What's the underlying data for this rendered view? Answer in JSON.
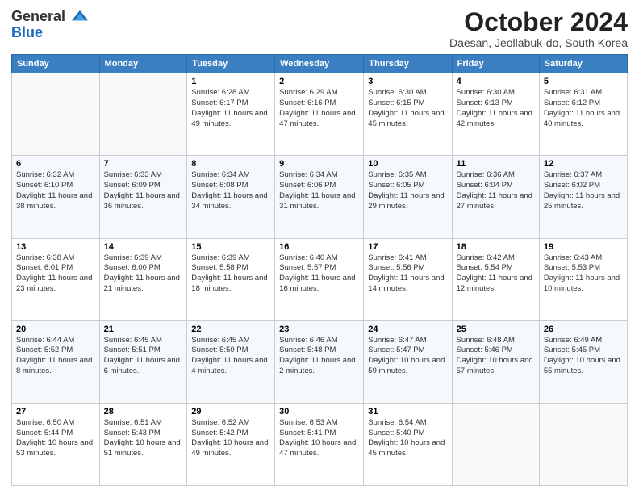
{
  "header": {
    "logo_line1": "General",
    "logo_line2": "Blue",
    "month": "October 2024",
    "location": "Daesan, Jeollabuk-do, South Korea"
  },
  "weekdays": [
    "Sunday",
    "Monday",
    "Tuesday",
    "Wednesday",
    "Thursday",
    "Friday",
    "Saturday"
  ],
  "weeks": [
    [
      {
        "day": "",
        "sunrise": "",
        "sunset": "",
        "daylight": ""
      },
      {
        "day": "",
        "sunrise": "",
        "sunset": "",
        "daylight": ""
      },
      {
        "day": "1",
        "sunrise": "Sunrise: 6:28 AM",
        "sunset": "Sunset: 6:17 PM",
        "daylight": "Daylight: 11 hours and 49 minutes."
      },
      {
        "day": "2",
        "sunrise": "Sunrise: 6:29 AM",
        "sunset": "Sunset: 6:16 PM",
        "daylight": "Daylight: 11 hours and 47 minutes."
      },
      {
        "day": "3",
        "sunrise": "Sunrise: 6:30 AM",
        "sunset": "Sunset: 6:15 PM",
        "daylight": "Daylight: 11 hours and 45 minutes."
      },
      {
        "day": "4",
        "sunrise": "Sunrise: 6:30 AM",
        "sunset": "Sunset: 6:13 PM",
        "daylight": "Daylight: 11 hours and 42 minutes."
      },
      {
        "day": "5",
        "sunrise": "Sunrise: 6:31 AM",
        "sunset": "Sunset: 6:12 PM",
        "daylight": "Daylight: 11 hours and 40 minutes."
      }
    ],
    [
      {
        "day": "6",
        "sunrise": "Sunrise: 6:32 AM",
        "sunset": "Sunset: 6:10 PM",
        "daylight": "Daylight: 11 hours and 38 minutes."
      },
      {
        "day": "7",
        "sunrise": "Sunrise: 6:33 AM",
        "sunset": "Sunset: 6:09 PM",
        "daylight": "Daylight: 11 hours and 36 minutes."
      },
      {
        "day": "8",
        "sunrise": "Sunrise: 6:34 AM",
        "sunset": "Sunset: 6:08 PM",
        "daylight": "Daylight: 11 hours and 34 minutes."
      },
      {
        "day": "9",
        "sunrise": "Sunrise: 6:34 AM",
        "sunset": "Sunset: 6:06 PM",
        "daylight": "Daylight: 11 hours and 31 minutes."
      },
      {
        "day": "10",
        "sunrise": "Sunrise: 6:35 AM",
        "sunset": "Sunset: 6:05 PM",
        "daylight": "Daylight: 11 hours and 29 minutes."
      },
      {
        "day": "11",
        "sunrise": "Sunrise: 6:36 AM",
        "sunset": "Sunset: 6:04 PM",
        "daylight": "Daylight: 11 hours and 27 minutes."
      },
      {
        "day": "12",
        "sunrise": "Sunrise: 6:37 AM",
        "sunset": "Sunset: 6:02 PM",
        "daylight": "Daylight: 11 hours and 25 minutes."
      }
    ],
    [
      {
        "day": "13",
        "sunrise": "Sunrise: 6:38 AM",
        "sunset": "Sunset: 6:01 PM",
        "daylight": "Daylight: 11 hours and 23 minutes."
      },
      {
        "day": "14",
        "sunrise": "Sunrise: 6:39 AM",
        "sunset": "Sunset: 6:00 PM",
        "daylight": "Daylight: 11 hours and 21 minutes."
      },
      {
        "day": "15",
        "sunrise": "Sunrise: 6:39 AM",
        "sunset": "Sunset: 5:58 PM",
        "daylight": "Daylight: 11 hours and 18 minutes."
      },
      {
        "day": "16",
        "sunrise": "Sunrise: 6:40 AM",
        "sunset": "Sunset: 5:57 PM",
        "daylight": "Daylight: 11 hours and 16 minutes."
      },
      {
        "day": "17",
        "sunrise": "Sunrise: 6:41 AM",
        "sunset": "Sunset: 5:56 PM",
        "daylight": "Daylight: 11 hours and 14 minutes."
      },
      {
        "day": "18",
        "sunrise": "Sunrise: 6:42 AM",
        "sunset": "Sunset: 5:54 PM",
        "daylight": "Daylight: 11 hours and 12 minutes."
      },
      {
        "day": "19",
        "sunrise": "Sunrise: 6:43 AM",
        "sunset": "Sunset: 5:53 PM",
        "daylight": "Daylight: 11 hours and 10 minutes."
      }
    ],
    [
      {
        "day": "20",
        "sunrise": "Sunrise: 6:44 AM",
        "sunset": "Sunset: 5:52 PM",
        "daylight": "Daylight: 11 hours and 8 minutes."
      },
      {
        "day": "21",
        "sunrise": "Sunrise: 6:45 AM",
        "sunset": "Sunset: 5:51 PM",
        "daylight": "Daylight: 11 hours and 6 minutes."
      },
      {
        "day": "22",
        "sunrise": "Sunrise: 6:45 AM",
        "sunset": "Sunset: 5:50 PM",
        "daylight": "Daylight: 11 hours and 4 minutes."
      },
      {
        "day": "23",
        "sunrise": "Sunrise: 6:46 AM",
        "sunset": "Sunset: 5:48 PM",
        "daylight": "Daylight: 11 hours and 2 minutes."
      },
      {
        "day": "24",
        "sunrise": "Sunrise: 6:47 AM",
        "sunset": "Sunset: 5:47 PM",
        "daylight": "Daylight: 10 hours and 59 minutes."
      },
      {
        "day": "25",
        "sunrise": "Sunrise: 6:48 AM",
        "sunset": "Sunset: 5:46 PM",
        "daylight": "Daylight: 10 hours and 57 minutes."
      },
      {
        "day": "26",
        "sunrise": "Sunrise: 6:49 AM",
        "sunset": "Sunset: 5:45 PM",
        "daylight": "Daylight: 10 hours and 55 minutes."
      }
    ],
    [
      {
        "day": "27",
        "sunrise": "Sunrise: 6:50 AM",
        "sunset": "Sunset: 5:44 PM",
        "daylight": "Daylight: 10 hours and 53 minutes."
      },
      {
        "day": "28",
        "sunrise": "Sunrise: 6:51 AM",
        "sunset": "Sunset: 5:43 PM",
        "daylight": "Daylight: 10 hours and 51 minutes."
      },
      {
        "day": "29",
        "sunrise": "Sunrise: 6:52 AM",
        "sunset": "Sunset: 5:42 PM",
        "daylight": "Daylight: 10 hours and 49 minutes."
      },
      {
        "day": "30",
        "sunrise": "Sunrise: 6:53 AM",
        "sunset": "Sunset: 5:41 PM",
        "daylight": "Daylight: 10 hours and 47 minutes."
      },
      {
        "day": "31",
        "sunrise": "Sunrise: 6:54 AM",
        "sunset": "Sunset: 5:40 PM",
        "daylight": "Daylight: 10 hours and 45 minutes."
      },
      {
        "day": "",
        "sunrise": "",
        "sunset": "",
        "daylight": ""
      },
      {
        "day": "",
        "sunrise": "",
        "sunset": "",
        "daylight": ""
      }
    ]
  ]
}
